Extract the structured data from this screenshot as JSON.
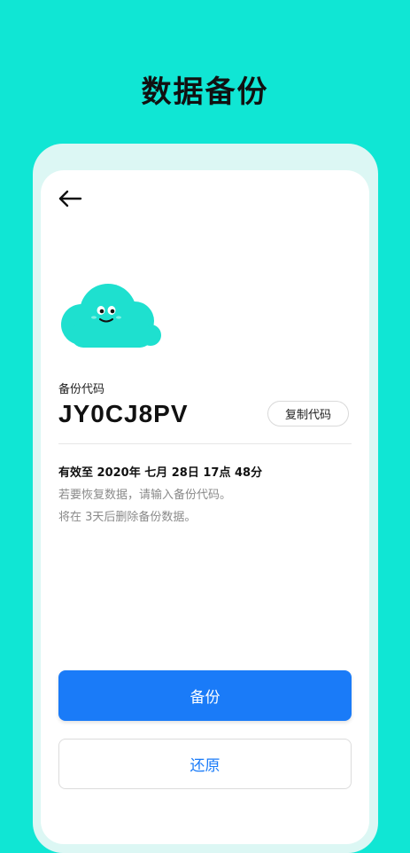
{
  "header": {
    "title": "数据备份"
  },
  "backup": {
    "code_label": "备份代码",
    "code": "JY0CJ8PV",
    "copy_button": "复制代码",
    "validity": "有效至 2020年 七月 28日 17点 48分",
    "hint_restore": "若要恢复数据，请输入备份代码。",
    "hint_delete": "将在 3天后删除备份数据。"
  },
  "actions": {
    "backup_button": "备份",
    "restore_button": "还原"
  },
  "icons": {
    "back": "arrow-left-icon",
    "mascot": "cloud-mascot-icon"
  },
  "colors": {
    "background": "#10e6d4",
    "primary": "#1a7bf8",
    "cloud": "#1ee0cf"
  }
}
